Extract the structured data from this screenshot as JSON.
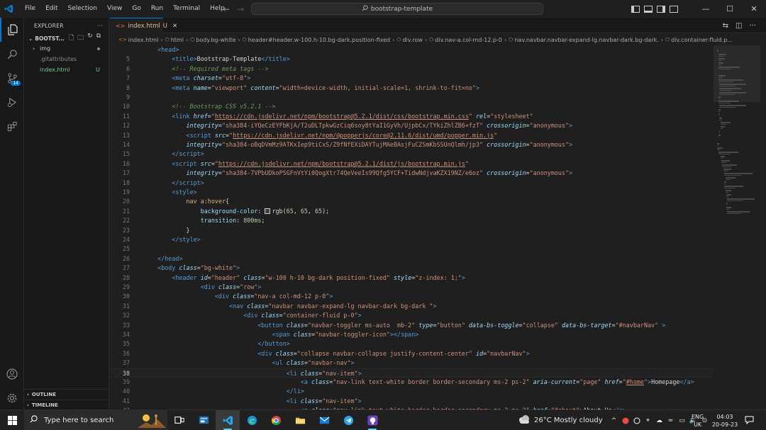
{
  "menu": [
    "File",
    "Edit",
    "Selection",
    "View",
    "Go",
    "Run",
    "Terminal",
    "Help"
  ],
  "search_text": "bootstrap-template",
  "sidebar": {
    "title": "EXPLORER",
    "folder": "BOOTST...",
    "items": [
      {
        "label": "img",
        "kind": "folder"
      },
      {
        "label": ".gitattributes",
        "kind": "file-gray"
      },
      {
        "label": "index.html",
        "kind": "file-modified",
        "status": "U"
      }
    ],
    "outline": "OUTLINE",
    "timeline": "TIMELINE",
    "scm_badge": "14"
  },
  "tab": {
    "label": "index.html",
    "status": "U"
  },
  "breadcrumb": [
    "index.html",
    "html",
    "body.bg-white",
    "header#header.w-100.h-10.bg-dark.position-fixed",
    "div.row",
    "div.nav-a.col-md-12.p-0",
    "nav.navbar.navbar-expand-lg.navbar-dark.bg-dark.",
    "div.container-fluid.p..."
  ],
  "code": [
    {
      "n": "",
      "t": [
        [
          "    ",
          ""
        ],
        [
          "<head>",
          "tag"
        ]
      ]
    },
    {
      "n": "5",
      "t": [
        [
          "        ",
          ""
        ],
        [
          "<",
          "tag"
        ],
        [
          "title",
          "tag"
        ],
        [
          ">",
          "tag"
        ],
        [
          "Bootstrap-Template",
          "txt"
        ],
        [
          "</",
          "tag"
        ],
        [
          "title",
          "tag"
        ],
        [
          ">",
          "tag"
        ]
      ]
    },
    {
      "n": "6",
      "t": [
        [
          "        ",
          ""
        ],
        [
          "<!-- Required meta tags -->",
          "com"
        ]
      ]
    },
    {
      "n": "7",
      "t": [
        [
          "        ",
          ""
        ],
        [
          "<",
          "tag"
        ],
        [
          "meta ",
          "tag"
        ],
        [
          "charset",
          "ital"
        ],
        [
          "=",
          "txt"
        ],
        [
          "\"utf-8\"",
          "str"
        ],
        [
          ">",
          "tag"
        ]
      ]
    },
    {
      "n": "8",
      "t": [
        [
          "        ",
          ""
        ],
        [
          "<",
          "tag"
        ],
        [
          "meta ",
          "tag"
        ],
        [
          "name",
          "ital"
        ],
        [
          "=",
          "txt"
        ],
        [
          "\"viewport\" ",
          "str"
        ],
        [
          "content",
          "ital"
        ],
        [
          "=",
          "txt"
        ],
        [
          "\"width=device-width, initial-scale=1, shrink-to-fit=no\"",
          "str"
        ],
        [
          ">",
          "tag"
        ]
      ]
    },
    {
      "n": "9",
      "t": []
    },
    {
      "n": "10",
      "t": [
        [
          "        ",
          ""
        ],
        [
          "<!-- Bootstrap CSS v5.2.1 -->",
          "com"
        ]
      ]
    },
    {
      "n": "11",
      "t": [
        [
          "        ",
          ""
        ],
        [
          "<",
          "tag"
        ],
        [
          "link ",
          "tag"
        ],
        [
          "href",
          "ital"
        ],
        [
          "=",
          "txt"
        ],
        [
          "\"",
          "str"
        ],
        [
          "https://cdn.jsdelivr.net/npm/bootstrap@5.2.1/dist/css/bootstrap.min.css",
          "strlink"
        ],
        [
          "\" ",
          "str"
        ],
        [
          "rel",
          "ital"
        ],
        [
          "=",
          "txt"
        ],
        [
          "\"stylesheet\"",
          "str"
        ]
      ]
    },
    {
      "n": "12",
      "t": [
        [
          "            ",
          ""
        ],
        [
          "integrity",
          "ital"
        ],
        [
          "=",
          "txt"
        ],
        [
          "\"sha384-iYQeCzEYFbKjA/T2uDLTpkwGzCiq6soy8tYaI1GyVh/UjpbCx/TYkiZhlZB6+fzT\" ",
          "str"
        ],
        [
          "crossorigin",
          "ital"
        ],
        [
          "=",
          "txt"
        ],
        [
          "\"anonymous\"",
          "str"
        ],
        [
          ">",
          "tag"
        ]
      ]
    },
    {
      "n": "13",
      "t": [
        [
          "            ",
          ""
        ],
        [
          "<",
          "tag"
        ],
        [
          "script ",
          "tag"
        ],
        [
          "src",
          "ital"
        ],
        [
          "=",
          "txt"
        ],
        [
          "\"",
          "str"
        ],
        [
          "https://cdn.jsdelivr.net/npm/@popperjs/core@2.11.6/dist/umd/popper.min.js",
          "strlink"
        ],
        [
          "\"",
          "str"
        ]
      ]
    },
    {
      "n": "14",
      "t": [
        [
          "            ",
          ""
        ],
        [
          "integrity",
          "ital"
        ],
        [
          "=",
          "txt"
        ],
        [
          "\"sha384-oBqDVmMz9ATKxIep9tiCxS/Z9fNfEXiDAYTujMAeBAsjFuCZSmKbSSUnQlmh/jp3\" ",
          "str"
        ],
        [
          "crossorigin",
          "ital"
        ],
        [
          "=",
          "txt"
        ],
        [
          "\"anonymous\"",
          "str"
        ],
        [
          ">",
          "tag"
        ]
      ]
    },
    {
      "n": "15",
      "t": [
        [
          "        ",
          ""
        ],
        [
          "</",
          "tag"
        ],
        [
          "script",
          "tag"
        ],
        [
          ">",
          "tag"
        ]
      ]
    },
    {
      "n": "16",
      "t": [
        [
          "        ",
          ""
        ],
        [
          "<",
          "tag"
        ],
        [
          "script ",
          "tag"
        ],
        [
          "src",
          "ital"
        ],
        [
          "=",
          "txt"
        ],
        [
          "\"",
          "str"
        ],
        [
          "https://cdn.jsdelivr.net/npm/bootstrap@5.2.1/dist/js/bootstrap.min.js",
          "strlink"
        ],
        [
          "\"",
          "str"
        ]
      ]
    },
    {
      "n": "17",
      "t": [
        [
          "            ",
          ""
        ],
        [
          "integrity",
          "ital"
        ],
        [
          "=",
          "txt"
        ],
        [
          "\"sha384-7VPbUDkoPSGFnVtYi0QogXtr74QeVeeIs99Qfg5YCF+TidwNdjvaKZX19NZ/e6oz\" ",
          "str"
        ],
        [
          "crossorigin",
          "ital"
        ],
        [
          "=",
          "txt"
        ],
        [
          "\"anonymous\"",
          "str"
        ],
        [
          ">",
          "tag"
        ]
      ]
    },
    {
      "n": "18",
      "t": [
        [
          "        ",
          ""
        ],
        [
          "</",
          "tag"
        ],
        [
          "script",
          "tag"
        ],
        [
          ">",
          "tag"
        ]
      ]
    },
    {
      "n": "19",
      "t": [
        [
          "        ",
          ""
        ],
        [
          "<",
          "tag"
        ],
        [
          "style",
          "tag"
        ],
        [
          ">",
          "tag"
        ]
      ]
    },
    {
      "n": "20",
      "t": [
        [
          "            ",
          ""
        ],
        [
          "nav ",
          "sel"
        ],
        [
          "a",
          "sel"
        ],
        [
          ":hover",
          "sel"
        ],
        [
          "{",
          "txt"
        ]
      ]
    },
    {
      "n": "21",
      "t": [
        [
          "                ",
          ""
        ],
        [
          "background-color",
          "prop"
        ],
        [
          ": ",
          "txt"
        ],
        [
          "SWATCH",
          "swatch"
        ],
        [
          "rgb(",
          "txt"
        ],
        [
          "65",
          "num"
        ],
        [
          ", ",
          "txt"
        ],
        [
          "65",
          "num"
        ],
        [
          ", ",
          "txt"
        ],
        [
          "65",
          "num"
        ],
        [
          ");",
          "txt"
        ]
      ]
    },
    {
      "n": "22",
      "t": [
        [
          "                ",
          ""
        ],
        [
          "transition",
          "prop"
        ],
        [
          ": ",
          "txt"
        ],
        [
          "800ms",
          "num"
        ],
        [
          ";",
          "txt"
        ]
      ]
    },
    {
      "n": "23",
      "t": [
        [
          "            ",
          ""
        ],
        [
          "}",
          "txt"
        ]
      ]
    },
    {
      "n": "24",
      "t": [
        [
          "        ",
          ""
        ],
        [
          "</",
          "tag"
        ],
        [
          "style",
          "tag"
        ],
        [
          ">",
          "tag"
        ]
      ]
    },
    {
      "n": "25",
      "t": []
    },
    {
      "n": "26",
      "t": [
        [
          "    ",
          ""
        ],
        [
          "</",
          "tag"
        ],
        [
          "head",
          "tag"
        ],
        [
          ">",
          "tag"
        ]
      ]
    },
    {
      "n": "27",
      "t": [
        [
          "    ",
          ""
        ],
        [
          "<",
          "tag"
        ],
        [
          "body ",
          "tag"
        ],
        [
          "class",
          "ital"
        ],
        [
          "=",
          "txt"
        ],
        [
          "\"bg-white\"",
          "str"
        ],
        [
          ">",
          "tag"
        ]
      ]
    },
    {
      "n": "28",
      "t": [
        [
          "        ",
          ""
        ],
        [
          "<",
          "tag"
        ],
        [
          "header ",
          "tag"
        ],
        [
          "id",
          "ital"
        ],
        [
          "=",
          "txt"
        ],
        [
          "\"header\" ",
          "str"
        ],
        [
          "class",
          "ital"
        ],
        [
          "=",
          "txt"
        ],
        [
          "\"w-100 h-10 bg-dark position-fixed\" ",
          "str"
        ],
        [
          "style",
          "ital"
        ],
        [
          "=",
          "txt"
        ],
        [
          "\"z-index: 1;\"",
          "str"
        ],
        [
          ">",
          "tag"
        ]
      ]
    },
    {
      "n": "29",
      "t": [
        [
          "                ",
          ""
        ],
        [
          "<",
          "tag"
        ],
        [
          "div ",
          "tag"
        ],
        [
          "class",
          "ital"
        ],
        [
          "=",
          "txt"
        ],
        [
          "\"row\"",
          "str"
        ],
        [
          ">",
          "tag"
        ]
      ]
    },
    {
      "n": "30",
      "t": [
        [
          "                    ",
          ""
        ],
        [
          "<",
          "tag"
        ],
        [
          "div ",
          "tag"
        ],
        [
          "class",
          "ital"
        ],
        [
          "=",
          "txt"
        ],
        [
          "\"nav-a col-md-12 p-0\"",
          "str"
        ],
        [
          ">",
          "tag"
        ]
      ]
    },
    {
      "n": "31",
      "t": [
        [
          "                        ",
          ""
        ],
        [
          "<",
          "tag"
        ],
        [
          "nav ",
          "tag"
        ],
        [
          "class",
          "ital"
        ],
        [
          "=",
          "txt"
        ],
        [
          "\"navbar navbar-expand-lg navbar-dark bg-dark \"",
          "str"
        ],
        [
          ">",
          "tag"
        ]
      ]
    },
    {
      "n": "32",
      "t": [
        [
          "                            ",
          ""
        ],
        [
          "<",
          "tag"
        ],
        [
          "div ",
          "tag"
        ],
        [
          "class",
          "ital"
        ],
        [
          "=",
          "txt"
        ],
        [
          "\"container-fluid p-0\"",
          "str"
        ],
        [
          ">",
          "tag"
        ]
      ]
    },
    {
      "n": "33",
      "t": [
        [
          "                                ",
          ""
        ],
        [
          "<",
          "tag"
        ],
        [
          "button ",
          "tag"
        ],
        [
          "class",
          "ital"
        ],
        [
          "=",
          "txt"
        ],
        [
          "\"navbar-toggler ms-auto  mb-2\" ",
          "str"
        ],
        [
          "type",
          "ital"
        ],
        [
          "=",
          "txt"
        ],
        [
          "\"button\" ",
          "str"
        ],
        [
          "data-bs-toggle",
          "ital"
        ],
        [
          "=",
          "txt"
        ],
        [
          "\"collapse\" ",
          "str"
        ],
        [
          "data-bs-target",
          "ital"
        ],
        [
          "=",
          "txt"
        ],
        [
          "\"#navbarNav\" ",
          "str"
        ],
        [
          ">",
          "tag"
        ]
      ]
    },
    {
      "n": "34",
      "t": [
        [
          "                                    ",
          ""
        ],
        [
          "<",
          "tag"
        ],
        [
          "span ",
          "tag"
        ],
        [
          "class",
          "ital"
        ],
        [
          "=",
          "txt"
        ],
        [
          "\"navbar-toggler-icon\"",
          "str"
        ],
        [
          "></",
          "tag"
        ],
        [
          "span",
          "tag"
        ],
        [
          ">",
          "tag"
        ]
      ]
    },
    {
      "n": "35",
      "t": [
        [
          "                                ",
          ""
        ],
        [
          "</",
          "tag"
        ],
        [
          "button",
          "tag"
        ],
        [
          ">",
          "tag"
        ]
      ]
    },
    {
      "n": "36",
      "t": [
        [
          "                                ",
          ""
        ],
        [
          "<",
          "tag"
        ],
        [
          "div ",
          "tag"
        ],
        [
          "class",
          "ital"
        ],
        [
          "=",
          "txt"
        ],
        [
          "\"collapse navbar-collapse justify-content-center\" ",
          "str"
        ],
        [
          "id",
          "ital"
        ],
        [
          "=",
          "txt"
        ],
        [
          "\"navbarNav\"",
          "str"
        ],
        [
          ">",
          "tag"
        ]
      ]
    },
    {
      "n": "37",
      "t": [
        [
          "                                    ",
          ""
        ],
        [
          "<",
          "tag"
        ],
        [
          "ul ",
          "tag"
        ],
        [
          "class",
          "ital"
        ],
        [
          "=",
          "txt"
        ],
        [
          "\"navbar-nav\"",
          "str"
        ],
        [
          ">",
          "tag"
        ]
      ]
    },
    {
      "n": "38",
      "t": [
        [
          "                                        ",
          ""
        ],
        [
          "<",
          "tag"
        ],
        [
          "li ",
          "tag"
        ],
        [
          "class",
          "ital"
        ],
        [
          "=",
          "txt"
        ],
        [
          "\"nav-item\"",
          "str"
        ],
        [
          ">",
          "tag"
        ]
      ],
      "cur": true
    },
    {
      "n": "39",
      "t": [
        [
          "                                            ",
          ""
        ],
        [
          "<",
          "tag"
        ],
        [
          "a ",
          "tag"
        ],
        [
          "class",
          "ital"
        ],
        [
          "=",
          "txt"
        ],
        [
          "\"nav-link text-white border border-secondary ms-2 ps-2\" ",
          "str"
        ],
        [
          "aria-current",
          "ital"
        ],
        [
          "=",
          "txt"
        ],
        [
          "\"page\" ",
          "str"
        ],
        [
          "href",
          "ital"
        ],
        [
          "=",
          "txt"
        ],
        [
          "\"",
          "str"
        ],
        [
          "#home",
          "strlink"
        ],
        [
          "\"",
          "str"
        ],
        [
          ">",
          "tag"
        ],
        [
          "Homepage",
          "txt"
        ],
        [
          "</",
          "tag"
        ],
        [
          "a",
          "tag"
        ],
        [
          ">",
          "tag"
        ]
      ]
    },
    {
      "n": "40",
      "t": [
        [
          "                                        ",
          ""
        ],
        [
          "</",
          "tag"
        ],
        [
          "li",
          "tag"
        ],
        [
          ">",
          "tag"
        ]
      ]
    },
    {
      "n": "41",
      "t": [
        [
          "                                        ",
          ""
        ],
        [
          "<",
          "tag"
        ],
        [
          "li ",
          "tag"
        ],
        [
          "class",
          "ital"
        ],
        [
          "=",
          "txt"
        ],
        [
          "\"nav-item\"",
          "str"
        ],
        [
          ">",
          "tag"
        ]
      ]
    },
    {
      "n": "42",
      "t": [
        [
          "                                            ",
          ""
        ],
        [
          "<",
          "tag"
        ],
        [
          "a ",
          "tag"
        ],
        [
          "class",
          "ital"
        ],
        [
          "=",
          "txt"
        ],
        [
          "\"nav-link text-white border border-secondary ms-2 ps-2\" ",
          "str"
        ],
        [
          "href",
          "ital"
        ],
        [
          "=",
          "txt"
        ],
        [
          "\"#about\"",
          "str"
        ],
        [
          ">",
          "tag"
        ],
        [
          "About Us",
          "txt"
        ],
        [
          "</",
          "tag"
        ],
        [
          "a",
          "tag"
        ],
        [
          ">",
          "tag"
        ]
      ]
    }
  ],
  "taskbar": {
    "search_placeholder": "Type here to search",
    "weather": "26°C  Mostly cloudy",
    "lang_top": "ENG",
    "lang_bottom": "UK",
    "time": "04:03",
    "date": "20-09-23"
  },
  "colors": {
    "accent": "#0078d4",
    "modified": "#73c991",
    "tab_text": "#e2c08d"
  }
}
